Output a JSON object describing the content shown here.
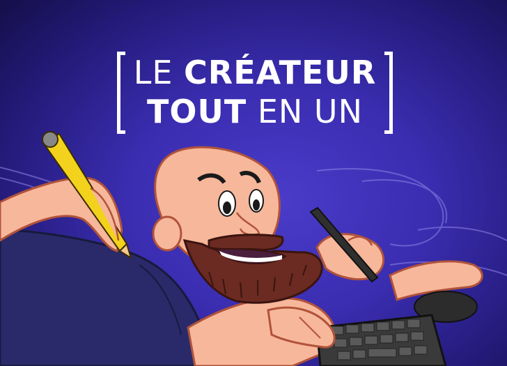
{
  "headline": {
    "line1_light": "LE",
    "line1_bold": "CRÉATEUR",
    "line2_bold": "TOUT",
    "line2_light": "EN UN"
  },
  "colors": {
    "background": "#3a2db0",
    "skin": "#f7b79b",
    "shirt": "#2a2a6a",
    "beard": "#6b2b22",
    "pencil": "#f2d21c",
    "keyboard": "#3a3a3a"
  },
  "illustration": {
    "subject": "bald bearded cartoon man lying on a desk, holding a yellow pencil and a stylus, typing on a keyboard"
  }
}
